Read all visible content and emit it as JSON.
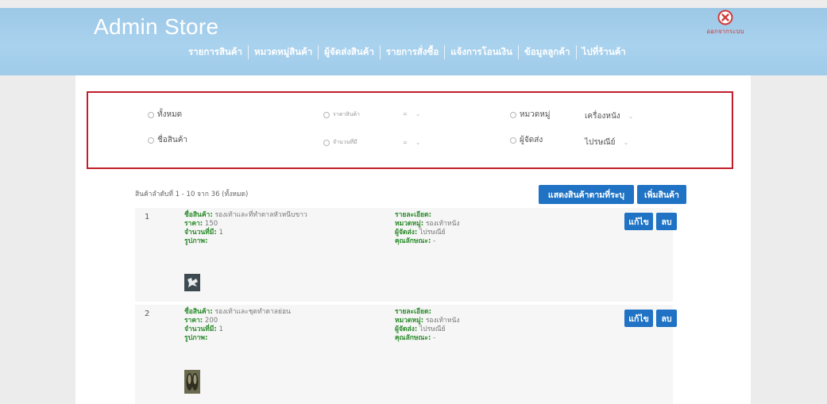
{
  "header": {
    "title": "Admin Store",
    "logout_label": "ออกจากระบบ",
    "nav": [
      "รายการสินค้า",
      "หมวดหมู่สินค้า",
      "ผู้จัดส่งสินค้า",
      "รายการสั่งซื้อ",
      "แจ้งการโอนเงิน",
      "ข้อมูลลูกค้า",
      "ไปที่ร้านค้า"
    ]
  },
  "filter": {
    "all_label": "ทั้งหมด",
    "name_label": "ชื่อสินค้า",
    "price_label": "ราคาสินค้า",
    "price_op": "=",
    "stock_label": "จำนวนที่มี",
    "stock_op": "=",
    "category_label": "หมวดหมู่",
    "category_value": "เครื่องหนัง",
    "shipper_label": "ผู้จัดส่ง",
    "shipper_value": "ไปรษณีย์"
  },
  "list": {
    "count_text": "สินค้าลำดับที่ 1 - 10 จาก 36 (ทั้งหมด)",
    "show_button": "แสดงสินค้าตามที่ระบุ",
    "add_button": "เพิ่มสินค้า",
    "edit_label": "แก้ไข",
    "delete_label": "ลบ",
    "labels": {
      "name": "ชื่อสินค้า:",
      "price": "ราคา:",
      "stock": "จำนวนที่มี:",
      "image": "รูปภาพ:",
      "detail": "รายละเอียด:",
      "category": "หมวดหมู่:",
      "shipper": "ผู้จัดส่ง:",
      "feature": "คุณลักษณะ:"
    },
    "items": [
      {
        "num": "1",
        "name": "รองเท้าและที่ทำดาลหัวหนีบขาว",
        "price": "150",
        "stock": "1",
        "category": "รองเท้าหนัง",
        "shipper": "ไปรษณีย์",
        "feature": "-"
      },
      {
        "num": "2",
        "name": "รองเท้าและชุดทำดาลย่อน",
        "price": "200",
        "stock": "1",
        "category": "รองเท้าหนัง",
        "shipper": "ไปรษณีย์",
        "feature": "-"
      }
    ]
  },
  "colors": {
    "header_bg": "#a9d2ee",
    "accent": "#1f72c4",
    "highlight_border": "#c11d2a",
    "label_green": "#2a8a2a"
  },
  "icons": {
    "logout": "close-circle-icon"
  }
}
